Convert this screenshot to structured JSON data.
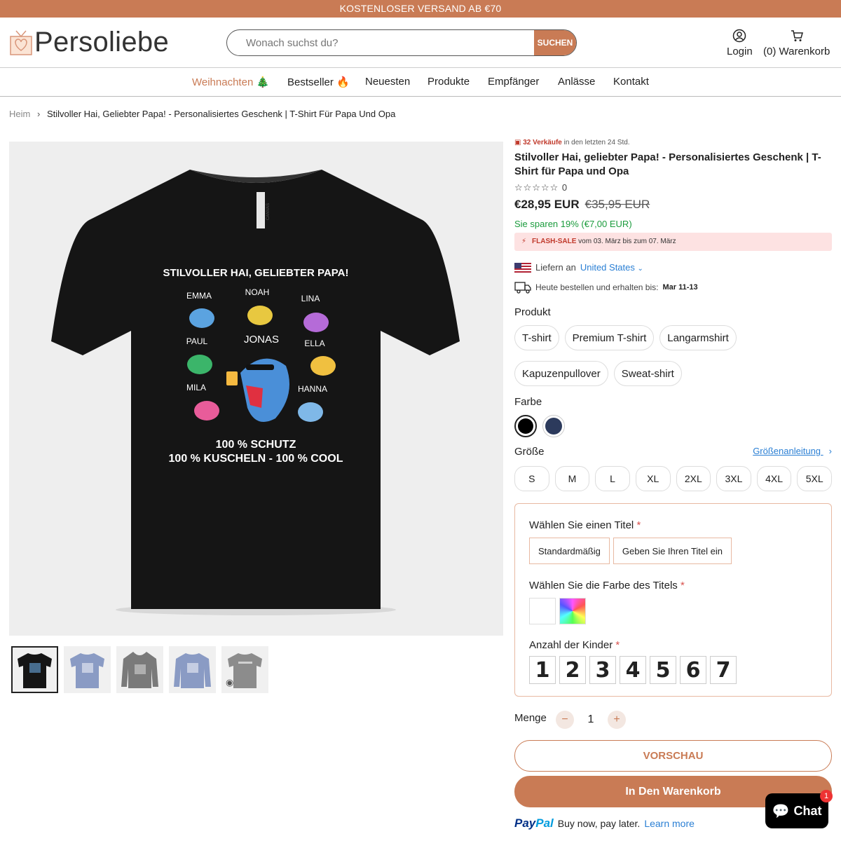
{
  "announcement": "KOSTENLOSER VERSAND AB €70",
  "brand": {
    "name": "Persoliebe",
    "accent": "#c97b55"
  },
  "search": {
    "placeholder": "Wonach suchst du?",
    "button": "SUCHEN"
  },
  "header": {
    "login": "Login",
    "cart": "(0) Warenkorb"
  },
  "nav": [
    "Weihnachten 🎄",
    "Bestseller 🔥",
    "Neuesten",
    "Produkte",
    "Empfänger",
    "Anlässe",
    "Kontakt"
  ],
  "breadcrumb": {
    "home": "Heim",
    "current": "Stilvoller Hai, Geliebter Papa! - Personalisiertes Geschenk | T-Shirt Für Papa Und Opa"
  },
  "shirt": {
    "headline": "STILVOLLER HAI, GELIEBTER PAPA!",
    "names": [
      "EMMA",
      "NOAH",
      "LINA",
      "PAUL",
      "JONAS",
      "ELLA",
      "MILA",
      "HANNA"
    ],
    "line1": "100 % SCHUTZ",
    "line2": "100 % KUSCHELN - 100 % COOL",
    "tag": "CANVAS"
  },
  "product": {
    "sold_count": "32 Verkäufe",
    "sold_suffix": " in den letzten 24 Std.",
    "title": "Stilvoller Hai, geliebter Papa! - Personalisiertes Geschenk | T-Shirt für Papa und Opa",
    "stars": "☆☆☆☆☆",
    "rating_count": "0",
    "price": "€28,95 EUR",
    "compare_price": "€35,95 EUR",
    "savings": "Sie sparen 19% (€7,00 EUR)",
    "flash_label": "FLASH-SALE",
    "flash_text": " vom 03. März bis zum 07. März",
    "ship_label": "Liefern an",
    "ship_country": "United States",
    "delivery_label": "Heute bestellen und erhalten bis:",
    "delivery_date": "Mar 11-13"
  },
  "options": {
    "product_label": "Produkt",
    "products": [
      "T-shirt",
      "Premium T-shirt",
      "Langarmshirt",
      "Kapuzenpullover",
      "Sweat-shirt"
    ],
    "color_label": "Farbe",
    "colors": [
      "#000000",
      "#2c3a5c"
    ],
    "size_label": "Größe",
    "size_guide": "Größenanleitung",
    "sizes": [
      "S",
      "M",
      "L",
      "XL",
      "2XL",
      "3XL",
      "4XL",
      "5XL"
    ]
  },
  "customize": {
    "title_label": "Wählen Sie einen Titel",
    "title_options": [
      "Standardmäßig",
      "Geben Sie Ihren Titel ein"
    ],
    "title_color_label": "Wählen Sie die Farbe des Titels",
    "kids_label": "Anzahl der Kinder",
    "kids_options": [
      "1",
      "2",
      "3",
      "4",
      "5",
      "6",
      "7"
    ],
    "required_mark": "*"
  },
  "quantity": {
    "label": "Menge",
    "value": "1",
    "minus": "−",
    "plus": "+"
  },
  "buttons": {
    "preview": "VORSCHAU",
    "add_to_cart": "In Den Warenkorb"
  },
  "paypal": {
    "brand_a": "Pay",
    "brand_b": "Pal",
    "text": "Buy now, pay later.",
    "link": "Learn more"
  },
  "chat": {
    "label": "Chat",
    "badge": "1"
  }
}
